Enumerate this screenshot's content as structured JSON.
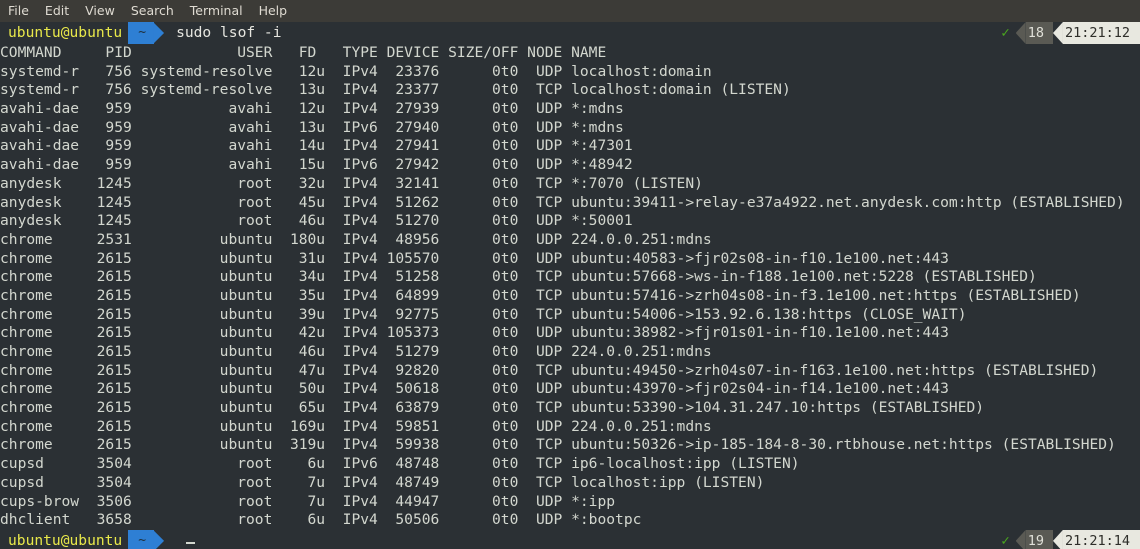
{
  "menu": {
    "items": [
      {
        "label": "File"
      },
      {
        "label": "Edit"
      },
      {
        "label": "View"
      },
      {
        "label": "Search"
      },
      {
        "label": "Terminal"
      },
      {
        "label": "Help"
      }
    ]
  },
  "colors": {
    "menubar_bg": "#3c3b37",
    "terminal_bg": "#2b3034",
    "text": "#d3d7cf",
    "prompt_user": "#e8e84a",
    "powerline_blue": "#2e7fd4",
    "status_gray": "#5a5a54",
    "status_light": "#e8e8e0",
    "check_green": "#4aa81e"
  },
  "top_prompt": {
    "user_host": "ubuntu@ubuntu",
    "path_segment": "~",
    "command": "sudo lsof -i",
    "status_icon": "check-icon",
    "history_number": "18",
    "time": "21:21:12"
  },
  "bottom_prompt": {
    "user_host": "ubuntu@ubuntu",
    "path_segment": "~",
    "command": "",
    "cursor": "_",
    "status_icon": "check-icon",
    "history_number": "19",
    "time": "21:21:14"
  },
  "table": {
    "headers": [
      "COMMAND",
      "PID",
      "USER",
      "FD",
      "TYPE",
      "DEVICE",
      "SIZE/OFF",
      "NODE",
      "NAME"
    ],
    "header_line": "COMMAND     PID            USER   FD   TYPE DEVICE SIZE/OFF NODE NAME",
    "rows": [
      {
        "command": "systemd-r",
        "pid": "756",
        "user": "systemd-resolve",
        "fd": "12u",
        "type": "IPv4",
        "device": "23376",
        "sizeoff": "0t0",
        "node": "UDP",
        "name": "localhost:domain",
        "line": "systemd-r   756 systemd-resolve   12u  IPv4  23376      0t0  UDP localhost:domain"
      },
      {
        "command": "systemd-r",
        "pid": "756",
        "user": "systemd-resolve",
        "fd": "13u",
        "type": "IPv4",
        "device": "23377",
        "sizeoff": "0t0",
        "node": "TCP",
        "name": "localhost:domain (LISTEN)",
        "line": "systemd-r   756 systemd-resolve   13u  IPv4  23377      0t0  TCP localhost:domain (LISTEN)"
      },
      {
        "command": "avahi-dae",
        "pid": "959",
        "user": "avahi",
        "fd": "12u",
        "type": "IPv4",
        "device": "27939",
        "sizeoff": "0t0",
        "node": "UDP",
        "name": "*:mdns",
        "line": "avahi-dae   959           avahi   12u  IPv4  27939      0t0  UDP *:mdns"
      },
      {
        "command": "avahi-dae",
        "pid": "959",
        "user": "avahi",
        "fd": "13u",
        "type": "IPv6",
        "device": "27940",
        "sizeoff": "0t0",
        "node": "UDP",
        "name": "*:mdns",
        "line": "avahi-dae   959           avahi   13u  IPv6  27940      0t0  UDP *:mdns"
      },
      {
        "command": "avahi-dae",
        "pid": "959",
        "user": "avahi",
        "fd": "14u",
        "type": "IPv4",
        "device": "27941",
        "sizeoff": "0t0",
        "node": "UDP",
        "name": "*:47301",
        "line": "avahi-dae   959           avahi   14u  IPv4  27941      0t0  UDP *:47301"
      },
      {
        "command": "avahi-dae",
        "pid": "959",
        "user": "avahi",
        "fd": "15u",
        "type": "IPv6",
        "device": "27942",
        "sizeoff": "0t0",
        "node": "UDP",
        "name": "*:48942",
        "line": "avahi-dae   959           avahi   15u  IPv6  27942      0t0  UDP *:48942"
      },
      {
        "command": "anydesk",
        "pid": "1245",
        "user": "root",
        "fd": "32u",
        "type": "IPv4",
        "device": "32141",
        "sizeoff": "0t0",
        "node": "TCP",
        "name": "*:7070 (LISTEN)",
        "line": "anydesk    1245            root   32u  IPv4  32141      0t0  TCP *:7070 (LISTEN)"
      },
      {
        "command": "anydesk",
        "pid": "1245",
        "user": "root",
        "fd": "45u",
        "type": "IPv4",
        "device": "51262",
        "sizeoff": "0t0",
        "node": "TCP",
        "name": "ubuntu:39411->relay-e37a4922.net.anydesk.com:http (ESTABLISHED)",
        "line": "anydesk    1245            root   45u  IPv4  51262      0t0  TCP ubuntu:39411->relay-e37a4922.net.anydesk.com:http (ESTABLISHED)"
      },
      {
        "command": "anydesk",
        "pid": "1245",
        "user": "root",
        "fd": "46u",
        "type": "IPv4",
        "device": "51270",
        "sizeoff": "0t0",
        "node": "UDP",
        "name": "*:50001",
        "line": "anydesk    1245            root   46u  IPv4  51270      0t0  UDP *:50001"
      },
      {
        "command": "chrome",
        "pid": "2531",
        "user": "ubuntu",
        "fd": "180u",
        "type": "IPv4",
        "device": "48956",
        "sizeoff": "0t0",
        "node": "UDP",
        "name": "224.0.0.251:mdns",
        "line": "chrome     2531          ubuntu  180u  IPv4  48956      0t0  UDP 224.0.0.251:mdns"
      },
      {
        "command": "chrome",
        "pid": "2615",
        "user": "ubuntu",
        "fd": "31u",
        "type": "IPv4",
        "device": "105570",
        "sizeoff": "0t0",
        "node": "UDP",
        "name": "ubuntu:40583->fjr02s08-in-f10.1e100.net:443",
        "line": "chrome     2615          ubuntu   31u  IPv4 105570      0t0  UDP ubuntu:40583->fjr02s08-in-f10.1e100.net:443"
      },
      {
        "command": "chrome",
        "pid": "2615",
        "user": "ubuntu",
        "fd": "34u",
        "type": "IPv4",
        "device": "51258",
        "sizeoff": "0t0",
        "node": "TCP",
        "name": "ubuntu:57668->ws-in-f188.1e100.net:5228 (ESTABLISHED)",
        "line": "chrome     2615          ubuntu   34u  IPv4  51258      0t0  TCP ubuntu:57668->ws-in-f188.1e100.net:5228 (ESTABLISHED)"
      },
      {
        "command": "chrome",
        "pid": "2615",
        "user": "ubuntu",
        "fd": "35u",
        "type": "IPv4",
        "device": "64899",
        "sizeoff": "0t0",
        "node": "TCP",
        "name": "ubuntu:57416->zrh04s08-in-f3.1e100.net:https (ESTABLISHED)",
        "line": "chrome     2615          ubuntu   35u  IPv4  64899      0t0  TCP ubuntu:57416->zrh04s08-in-f3.1e100.net:https (ESTABLISHED)"
      },
      {
        "command": "chrome",
        "pid": "2615",
        "user": "ubuntu",
        "fd": "39u",
        "type": "IPv4",
        "device": "92775",
        "sizeoff": "0t0",
        "node": "TCP",
        "name": "ubuntu:54006->153.92.6.138:https (CLOSE_WAIT)",
        "line": "chrome     2615          ubuntu   39u  IPv4  92775      0t0  TCP ubuntu:54006->153.92.6.138:https (CLOSE_WAIT)"
      },
      {
        "command": "chrome",
        "pid": "2615",
        "user": "ubuntu",
        "fd": "42u",
        "type": "IPv4",
        "device": "105373",
        "sizeoff": "0t0",
        "node": "UDP",
        "name": "ubuntu:38982->fjr01s01-in-f10.1e100.net:443",
        "line": "chrome     2615          ubuntu   42u  IPv4 105373      0t0  UDP ubuntu:38982->fjr01s01-in-f10.1e100.net:443"
      },
      {
        "command": "chrome",
        "pid": "2615",
        "user": "ubuntu",
        "fd": "46u",
        "type": "IPv4",
        "device": "51279",
        "sizeoff": "0t0",
        "node": "UDP",
        "name": "224.0.0.251:mdns",
        "line": "chrome     2615          ubuntu   46u  IPv4  51279      0t0  UDP 224.0.0.251:mdns"
      },
      {
        "command": "chrome",
        "pid": "2615",
        "user": "ubuntu",
        "fd": "47u",
        "type": "IPv4",
        "device": "92820",
        "sizeoff": "0t0",
        "node": "TCP",
        "name": "ubuntu:49450->zrh04s07-in-f163.1e100.net:https (ESTABLISHED)",
        "line": "chrome     2615          ubuntu   47u  IPv4  92820      0t0  TCP ubuntu:49450->zrh04s07-in-f163.1e100.net:https (ESTABLISHED)"
      },
      {
        "command": "chrome",
        "pid": "2615",
        "user": "ubuntu",
        "fd": "50u",
        "type": "IPv4",
        "device": "50618",
        "sizeoff": "0t0",
        "node": "UDP",
        "name": "ubuntu:43970->fjr02s04-in-f14.1e100.net:443",
        "line": "chrome     2615          ubuntu   50u  IPv4  50618      0t0  UDP ubuntu:43970->fjr02s04-in-f14.1e100.net:443"
      },
      {
        "command": "chrome",
        "pid": "2615",
        "user": "ubuntu",
        "fd": "65u",
        "type": "IPv4",
        "device": "63879",
        "sizeoff": "0t0",
        "node": "TCP",
        "name": "ubuntu:53390->104.31.247.10:https (ESTABLISHED)",
        "line": "chrome     2615          ubuntu   65u  IPv4  63879      0t0  TCP ubuntu:53390->104.31.247.10:https (ESTABLISHED)"
      },
      {
        "command": "chrome",
        "pid": "2615",
        "user": "ubuntu",
        "fd": "169u",
        "type": "IPv4",
        "device": "59851",
        "sizeoff": "0t0",
        "node": "UDP",
        "name": "224.0.0.251:mdns",
        "line": "chrome     2615          ubuntu  169u  IPv4  59851      0t0  UDP 224.0.0.251:mdns"
      },
      {
        "command": "chrome",
        "pid": "2615",
        "user": "ubuntu",
        "fd": "319u",
        "type": "IPv4",
        "device": "59938",
        "sizeoff": "0t0",
        "node": "TCP",
        "name": "ubuntu:50326->ip-185-184-8-30.rtbhouse.net:https (ESTABLISHED)",
        "line": "chrome     2615          ubuntu  319u  IPv4  59938      0t0  TCP ubuntu:50326->ip-185-184-8-30.rtbhouse.net:https (ESTABLISHED)"
      },
      {
        "command": "cupsd",
        "pid": "3504",
        "user": "root",
        "fd": "6u",
        "type": "IPv6",
        "device": "48748",
        "sizeoff": "0t0",
        "node": "TCP",
        "name": "ip6-localhost:ipp (LISTEN)",
        "line": "cupsd      3504            root    6u  IPv6  48748      0t0  TCP ip6-localhost:ipp (LISTEN)"
      },
      {
        "command": "cupsd",
        "pid": "3504",
        "user": "root",
        "fd": "7u",
        "type": "IPv4",
        "device": "48749",
        "sizeoff": "0t0",
        "node": "TCP",
        "name": "localhost:ipp (LISTEN)",
        "line": "cupsd      3504            root    7u  IPv4  48749      0t0  TCP localhost:ipp (LISTEN)"
      },
      {
        "command": "cups-brow",
        "pid": "3506",
        "user": "root",
        "fd": "7u",
        "type": "IPv4",
        "device": "44947",
        "sizeoff": "0t0",
        "node": "UDP",
        "name": "*:ipp",
        "line": "cups-brow  3506            root    7u  IPv4  44947      0t0  UDP *:ipp"
      },
      {
        "command": "dhclient",
        "pid": "3658",
        "user": "root",
        "fd": "6u",
        "type": "IPv4",
        "device": "50506",
        "sizeoff": "0t0",
        "node": "UDP",
        "name": "*:bootpc",
        "line": "dhclient   3658            root    6u  IPv4  50506      0t0  UDP *:bootpc"
      }
    ]
  }
}
